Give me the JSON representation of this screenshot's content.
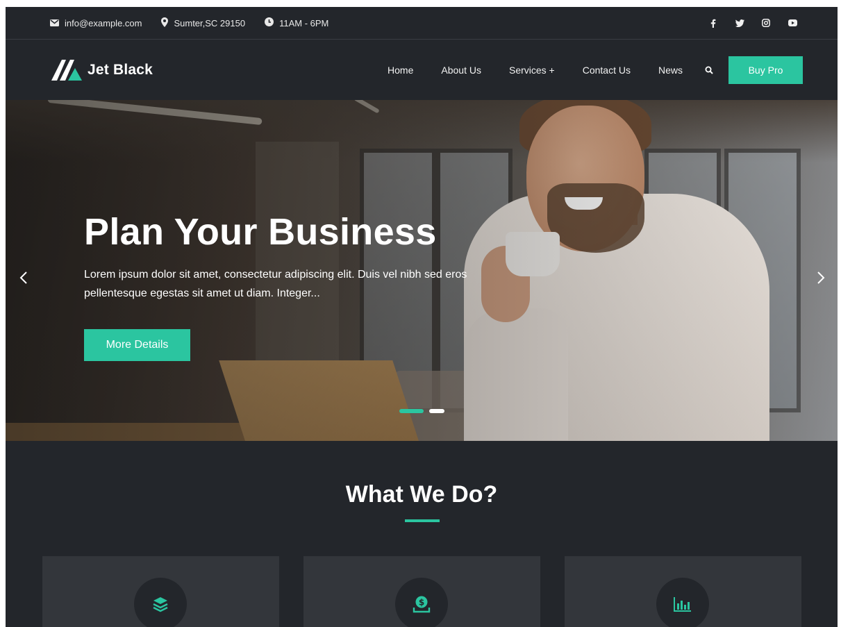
{
  "topbar": {
    "email": "info@example.com",
    "location": "Sumter,SC 29150",
    "hours": "11AM - 6PM",
    "social": [
      "facebook-icon",
      "twitter-icon",
      "instagram-icon",
      "youtube-icon"
    ]
  },
  "nav": {
    "logo_text": "Jet Black",
    "items": [
      {
        "label": "Home"
      },
      {
        "label": "About Us"
      },
      {
        "label": "Services +"
      },
      {
        "label": "Contact Us"
      },
      {
        "label": "News"
      }
    ],
    "buy_label": "Buy Pro"
  },
  "hero": {
    "title": "Plan Your Business",
    "description": "Lorem ipsum dolor sit amet, consectetur adipiscing elit. Duis vel nibh sed eros pellentesque egestas sit amet ut diam. Integer...",
    "button_label": "More Details",
    "slides_total": 2,
    "active_slide": 1
  },
  "section": {
    "title": "What We Do?",
    "cards": [
      {
        "icon": "layers-icon"
      },
      {
        "icon": "money-icon"
      },
      {
        "icon": "bar-chart-icon"
      }
    ]
  },
  "colors": {
    "accent": "#2bc5a0",
    "background": "#23262b",
    "card": "#33363b"
  }
}
